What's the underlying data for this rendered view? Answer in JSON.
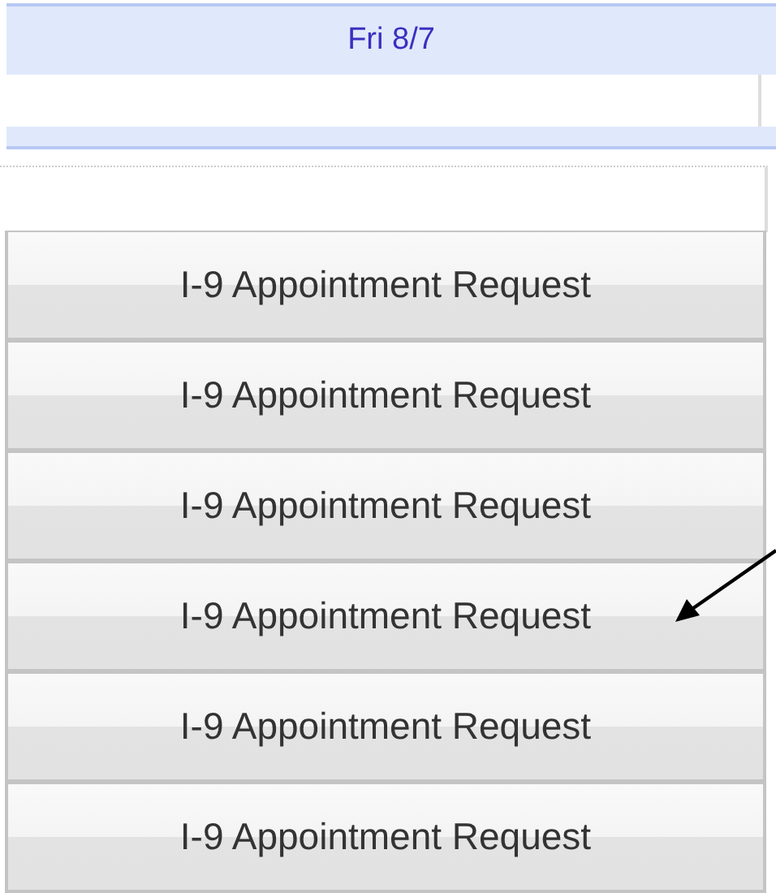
{
  "day_header": {
    "label": "Fri 8/7"
  },
  "slots": [
    {
      "label": "I-9 Appointment Request"
    },
    {
      "label": "I-9 Appointment Request"
    },
    {
      "label": "I-9 Appointment Request"
    },
    {
      "label": "I-9 Appointment Request"
    },
    {
      "label": "I-9 Appointment Request"
    },
    {
      "label": "I-9 Appointment Request"
    }
  ]
}
